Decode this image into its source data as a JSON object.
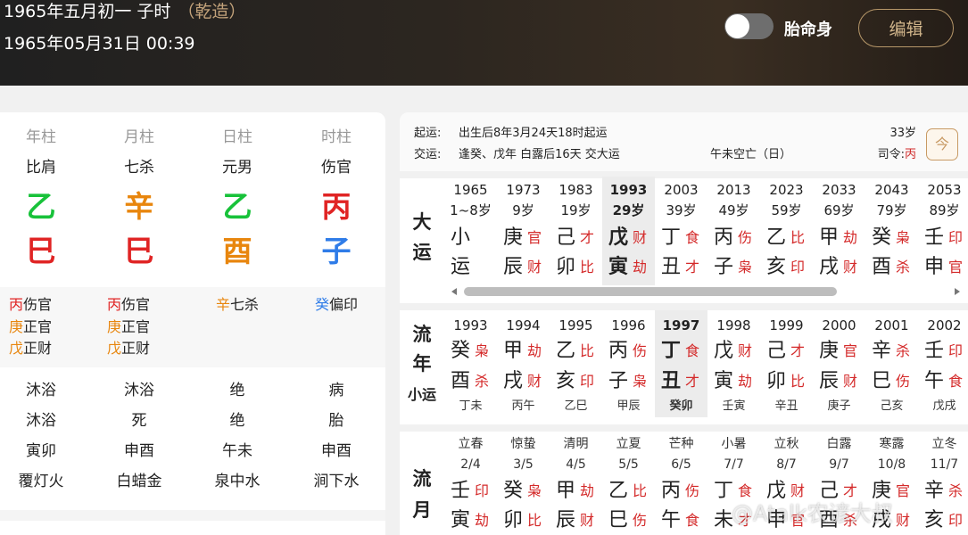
{
  "header": {
    "title": "1965年五月初一 子时",
    "qianzao": "（乾造）",
    "date": "1965年05月31日 00:39",
    "toggle_label": "胎命身",
    "edit_label": "编辑"
  },
  "colors": {
    "wood": "#18c23a",
    "fire": "#e02424",
    "earth": "#e8860e",
    "metal": "#e8860e",
    "water": "#2f7ce8",
    "god_red": "#d42a2a"
  },
  "pillars": [
    {
      "label": "年柱",
      "ten_god": "比肩",
      "stem": "乙",
      "stem_el": "wood",
      "branch": "巳",
      "branch_el": "fire",
      "hidden": [
        {
          "stem": "丙",
          "el": "fire",
          "god": "伤官"
        },
        {
          "stem": "庚",
          "el": "metal",
          "god": "正官"
        },
        {
          "stem": "戊",
          "el": "earth",
          "god": "正财"
        }
      ],
      "xingyun": "沐浴",
      "zizuo": "沐浴",
      "kongwang": "寅卯",
      "nayin": "覆灯火"
    },
    {
      "label": "月柱",
      "ten_god": "七杀",
      "stem": "辛",
      "stem_el": "metal",
      "branch": "巳",
      "branch_el": "fire",
      "hidden": [
        {
          "stem": "丙",
          "el": "fire",
          "god": "伤官"
        },
        {
          "stem": "庚",
          "el": "metal",
          "god": "正官"
        },
        {
          "stem": "戊",
          "el": "earth",
          "god": "正财"
        }
      ],
      "xingyun": "沐浴",
      "zizuo": "死",
      "kongwang": "申酉",
      "nayin": "白蜡金"
    },
    {
      "label": "日柱",
      "ten_god": "元男",
      "stem": "乙",
      "stem_el": "wood",
      "branch": "酉",
      "branch_el": "metal",
      "hidden": [
        {
          "stem": "辛",
          "el": "metal",
          "god": "七杀"
        }
      ],
      "xingyun": "绝",
      "zizuo": "绝",
      "kongwang": "午未",
      "nayin": "泉中水"
    },
    {
      "label": "时柱",
      "ten_god": "伤官",
      "stem": "丙",
      "stem_el": "fire",
      "branch": "子",
      "branch_el": "water",
      "hidden": [
        {
          "stem": "癸",
          "el": "water",
          "god": "偏印"
        }
      ],
      "xingyun": "病",
      "zizuo": "胎",
      "kongwang": "申酉",
      "nayin": "涧下水"
    }
  ],
  "info": {
    "qiyun_label": "起运:",
    "qiyun": "出生后8年3月24天18时起运",
    "jiaoyun_label": "交运:",
    "jiaoyun": "逢癸、戊年 白露后16天 交大运",
    "kongwang": "午未空亡（日）",
    "age": "33岁",
    "siling_label": "司令:",
    "siling_value": "丙",
    "calendar_icon_text": "今"
  },
  "dayun": {
    "label_a": "大",
    "label_b": "运",
    "items": [
      {
        "year": "1965",
        "age": "1~8岁",
        "stem": "小",
        "sg": "",
        "branch": "运",
        "bg": ""
      },
      {
        "year": "1973",
        "age": "9岁",
        "stem": "庚",
        "sg": "官",
        "branch": "辰",
        "bg": "财"
      },
      {
        "year": "1983",
        "age": "19岁",
        "stem": "己",
        "sg": "才",
        "branch": "卯",
        "bg": "比"
      },
      {
        "year": "1993",
        "age": "29岁",
        "stem": "戊",
        "sg": "财",
        "branch": "寅",
        "bg": "劫",
        "selected": true
      },
      {
        "year": "2003",
        "age": "39岁",
        "stem": "丁",
        "sg": "食",
        "branch": "丑",
        "bg": "才"
      },
      {
        "year": "2013",
        "age": "49岁",
        "stem": "丙",
        "sg": "伤",
        "branch": "子",
        "bg": "枭"
      },
      {
        "year": "2023",
        "age": "59岁",
        "stem": "乙",
        "sg": "比",
        "branch": "亥",
        "bg": "印"
      },
      {
        "year": "2033",
        "age": "69岁",
        "stem": "甲",
        "sg": "劫",
        "branch": "戌",
        "bg": "财"
      },
      {
        "year": "2043",
        "age": "79岁",
        "stem": "癸",
        "sg": "枭",
        "branch": "酉",
        "bg": "杀"
      },
      {
        "year": "2053",
        "age": "89岁",
        "stem": "壬",
        "sg": "印",
        "branch": "申",
        "bg": "官"
      }
    ]
  },
  "liunian": {
    "label_a": "流",
    "label_b": "年",
    "label_c": "小运",
    "items": [
      {
        "year": "1993",
        "stem": "癸",
        "sg": "枭",
        "branch": "酉",
        "bg": "杀",
        "xiaoyun": "丁未"
      },
      {
        "year": "1994",
        "stem": "甲",
        "sg": "劫",
        "branch": "戌",
        "bg": "财",
        "xiaoyun": "丙午"
      },
      {
        "year": "1995",
        "stem": "乙",
        "sg": "比",
        "branch": "亥",
        "bg": "印",
        "xiaoyun": "乙巳"
      },
      {
        "year": "1996",
        "stem": "丙",
        "sg": "伤",
        "branch": "子",
        "bg": "枭",
        "xiaoyun": "甲辰"
      },
      {
        "year": "1997",
        "stem": "丁",
        "sg": "食",
        "branch": "丑",
        "bg": "才",
        "xiaoyun": "癸卯",
        "selected": true
      },
      {
        "year": "1998",
        "stem": "戊",
        "sg": "财",
        "branch": "寅",
        "bg": "劫",
        "xiaoyun": "壬寅"
      },
      {
        "year": "1999",
        "stem": "己",
        "sg": "才",
        "branch": "卯",
        "bg": "比",
        "xiaoyun": "辛丑"
      },
      {
        "year": "2000",
        "stem": "庚",
        "sg": "官",
        "branch": "辰",
        "bg": "财",
        "xiaoyun": "庚子"
      },
      {
        "year": "2001",
        "stem": "辛",
        "sg": "杀",
        "branch": "巳",
        "bg": "伤",
        "xiaoyun": "己亥"
      },
      {
        "year": "2002",
        "stem": "壬",
        "sg": "印",
        "branch": "午",
        "bg": "食",
        "xiaoyun": "戊戌"
      }
    ]
  },
  "liuyue": {
    "label_a": "流",
    "label_b": "月",
    "items": [
      {
        "term": "立春",
        "date": "2/4",
        "stem": "壬",
        "sg": "印",
        "branch": "寅",
        "bg": "劫"
      },
      {
        "term": "惊蛰",
        "date": "3/5",
        "stem": "癸",
        "sg": "枭",
        "branch": "卯",
        "bg": "比"
      },
      {
        "term": "清明",
        "date": "4/5",
        "stem": "甲",
        "sg": "劫",
        "branch": "辰",
        "bg": "财"
      },
      {
        "term": "立夏",
        "date": "5/5",
        "stem": "乙",
        "sg": "比",
        "branch": "巳",
        "bg": "伤"
      },
      {
        "term": "芒种",
        "date": "6/5",
        "stem": "丙",
        "sg": "伤",
        "branch": "午",
        "bg": "食"
      },
      {
        "term": "小暑",
        "date": "7/7",
        "stem": "丁",
        "sg": "食",
        "branch": "未",
        "bg": "才"
      },
      {
        "term": "立秋",
        "date": "8/7",
        "stem": "戊",
        "sg": "财",
        "branch": "申",
        "bg": "官"
      },
      {
        "term": "白露",
        "date": "9/7",
        "stem": "己",
        "sg": "才",
        "branch": "酉",
        "bg": "杀"
      },
      {
        "term": "寒露",
        "date": "10/8",
        "stem": "庚",
        "sg": "官",
        "branch": "戌",
        "bg": "财"
      },
      {
        "term": "立冬",
        "date": "11/7",
        "stem": "辛",
        "sg": "杀",
        "branch": "亥",
        "bg": "印"
      }
    ]
  },
  "watermark": "@Atalk农谚大叔"
}
